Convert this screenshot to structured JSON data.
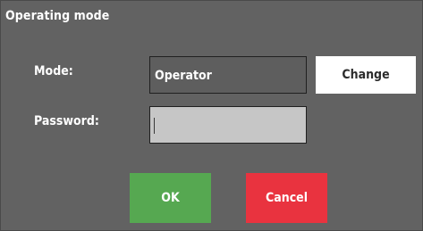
{
  "dialog": {
    "title": "Operating mode"
  },
  "mode": {
    "label": "Mode:",
    "value": "Operator",
    "change_label": "Change"
  },
  "password": {
    "label": "Password:",
    "value": ""
  },
  "actions": {
    "ok_label": "OK",
    "cancel_label": "Cancel"
  },
  "colors": {
    "background": "#626262",
    "password_field": "#c6c6c6",
    "ok": "#56a851",
    "cancel": "#e9333f",
    "change": "#ffffff"
  }
}
